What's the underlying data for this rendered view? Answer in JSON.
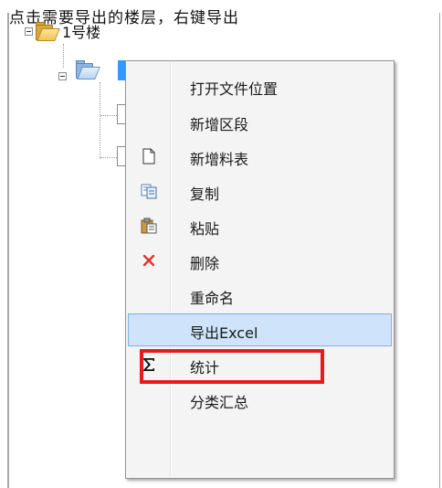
{
  "top_text": "点击需要导出的楼层，右键导出",
  "tree": {
    "root_label": "1号楼"
  },
  "context_menu": {
    "items": [
      {
        "label": "打开文件位置",
        "icon": "none"
      },
      {
        "label": "新增区段",
        "icon": "none"
      },
      {
        "label": "新增料表",
        "icon": "new-document-icon"
      },
      {
        "label": "复制",
        "icon": "copy-icon"
      },
      {
        "label": "粘贴",
        "icon": "paste-icon"
      },
      {
        "label": "删除",
        "icon": "delete-icon"
      },
      {
        "label": "重命名",
        "icon": "none"
      },
      {
        "label": "导出Excel",
        "icon": "none",
        "state": "hover"
      },
      {
        "label": "统计",
        "icon": "sigma-icon"
      },
      {
        "label": "分类汇总",
        "icon": "none"
      }
    ]
  },
  "colors": {
    "selection": "#3399ff",
    "hover_bg": "#cfe4fb",
    "callout_border": "#e81b1b",
    "delete_icon": "#e0342a"
  }
}
